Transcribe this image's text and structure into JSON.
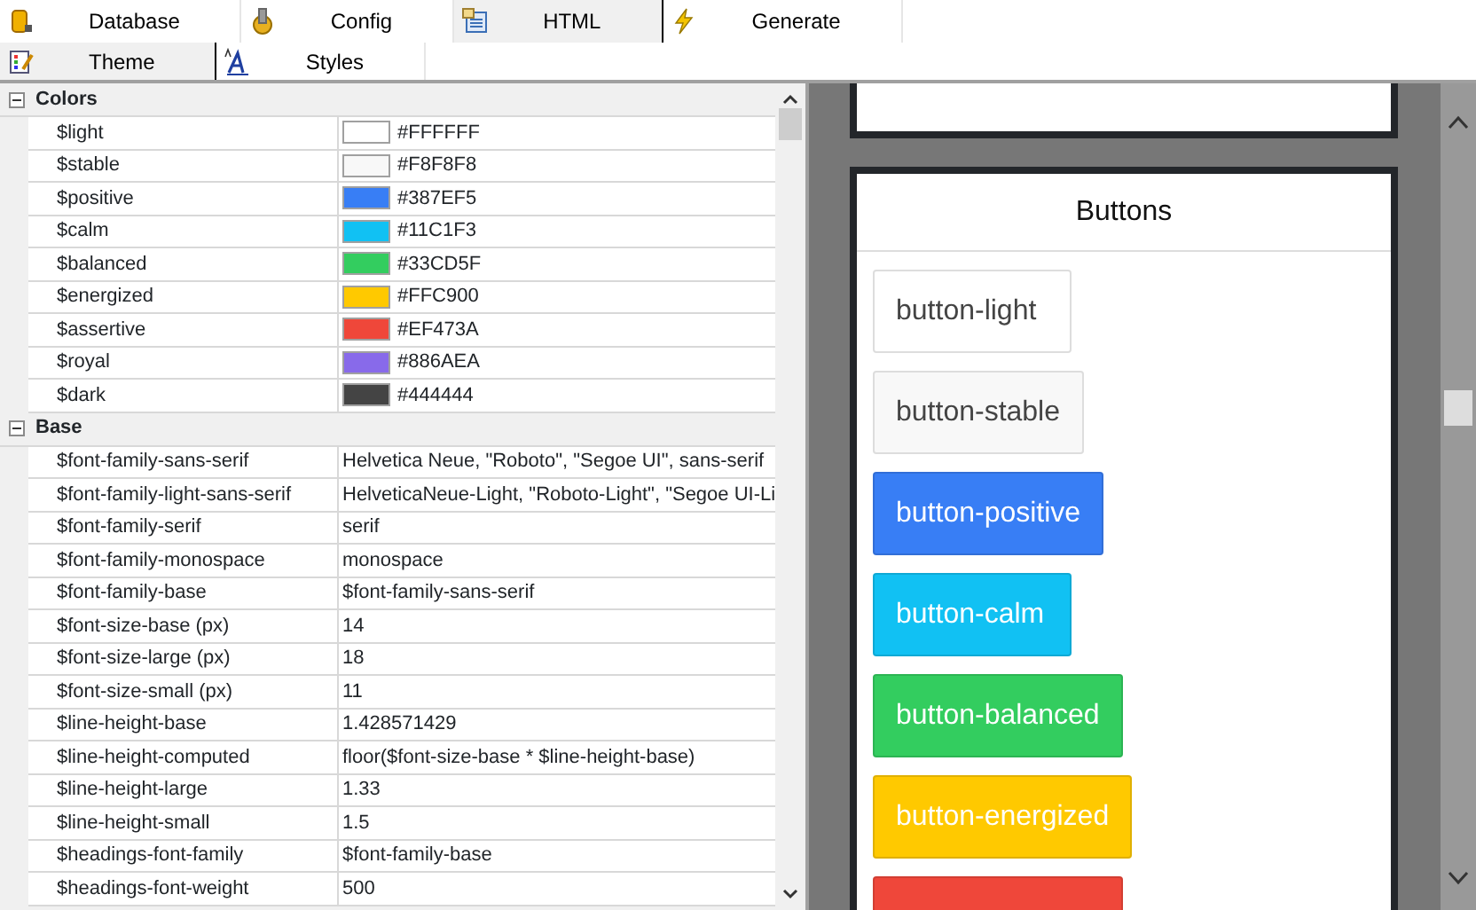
{
  "main_tabs": [
    {
      "label": "Database",
      "selected": false,
      "kind": "database"
    },
    {
      "label": "Config",
      "selected": false,
      "kind": "config"
    },
    {
      "label": "HTML",
      "selected": true,
      "kind": "html"
    },
    {
      "label": "Generate",
      "selected": false,
      "kind": "generate"
    }
  ],
  "sub_tabs": [
    {
      "label": "Theme",
      "selected": true,
      "kind": "theme"
    },
    {
      "label": "Styles",
      "selected": false,
      "kind": "styles"
    }
  ],
  "property_grid": {
    "categories": [
      {
        "name": "Colors",
        "expanded": true,
        "rows": [
          {
            "name": "$light",
            "value": "#FFFFFF",
            "color": "#ffffff"
          },
          {
            "name": "$stable",
            "value": "#F8F8F8",
            "color": "#f8f8f8"
          },
          {
            "name": "$positive",
            "value": "#387EF5",
            "color": "#387ef5"
          },
          {
            "name": "$calm",
            "value": "#11C1F3",
            "color": "#11c1f3"
          },
          {
            "name": "$balanced",
            "value": "#33CD5F",
            "color": "#33cd5f"
          },
          {
            "name": "$energized",
            "value": "#FFC900",
            "color": "#ffc900"
          },
          {
            "name": "$assertive",
            "value": "#EF473A",
            "color": "#ef473a"
          },
          {
            "name": "$royal",
            "value": "#886AEA",
            "color": "#886aea"
          },
          {
            "name": "$dark",
            "value": "#444444",
            "color": "#444444"
          }
        ]
      },
      {
        "name": "Base",
        "expanded": true,
        "rows": [
          {
            "name": "$font-family-sans-serif",
            "value": "Helvetica Neue, \"Roboto\", \"Segoe UI\", sans-serif"
          },
          {
            "name": "$font-family-light-sans-serif",
            "value": "HelveticaNeue-Light, \"Roboto-Light\", \"Segoe UI-Li"
          },
          {
            "name": "$font-family-serif",
            "value": "serif"
          },
          {
            "name": "$font-family-monospace",
            "value": "monospace"
          },
          {
            "name": "$font-family-base",
            "value": "$font-family-sans-serif"
          },
          {
            "name": "$font-size-base (px)",
            "value": "14"
          },
          {
            "name": "$font-size-large (px)",
            "value": "18"
          },
          {
            "name": "$font-size-small (px)",
            "value": "11"
          },
          {
            "name": "$line-height-base",
            "value": "1.428571429"
          },
          {
            "name": "$line-height-computed",
            "value": "floor($font-size-base * $line-height-base)"
          },
          {
            "name": "$line-height-large",
            "value": "1.33"
          },
          {
            "name": "$line-height-small",
            "value": "1.5"
          },
          {
            "name": "$headings-font-family",
            "value": "$font-family-base"
          },
          {
            "name": "$headings-font-weight",
            "value": "500"
          }
        ]
      }
    ]
  },
  "preview": {
    "card_title": "Buttons",
    "buttons": [
      {
        "label": "button-light",
        "color": "#ffffff",
        "kind": "outlined"
      },
      {
        "label": "button-stable",
        "color": "#f8f8f8",
        "kind": "outlined"
      },
      {
        "label": "button-positive",
        "color": "#387ef5",
        "kind": "filled"
      },
      {
        "label": "button-calm",
        "color": "#11c1f3",
        "kind": "filled"
      },
      {
        "label": "button-balanced",
        "color": "#33cd5f",
        "kind": "filled"
      },
      {
        "label": "button-energized",
        "color": "#ffc900",
        "kind": "filled"
      },
      {
        "color": "#ef473a",
        "kind": "filled"
      }
    ]
  }
}
